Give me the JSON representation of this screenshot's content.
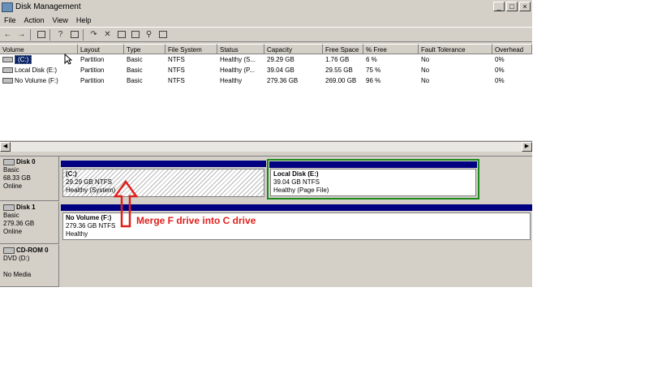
{
  "window": {
    "title": "Disk Management",
    "controls": [
      "_",
      "□",
      "×"
    ]
  },
  "menu": [
    "File",
    "Action",
    "View",
    "Help"
  ],
  "list": {
    "columns": [
      "Volume",
      "Layout",
      "Type",
      "File System",
      "Status",
      "Capacity",
      "Free Space",
      "% Free",
      "Fault Tolerance",
      "Overhead"
    ],
    "rows": [
      [
        "(C:)",
        "Partition",
        "Basic",
        "NTFS",
        "Healthy (S...",
        "29.29 GB",
        "1.76 GB",
        "6 %",
        "No",
        "0%"
      ],
      [
        "Local Disk (E:)",
        "Partition",
        "Basic",
        "NTFS",
        "Healthy (P...",
        "39.04 GB",
        "29.55 GB",
        "75 %",
        "No",
        "0%"
      ],
      [
        "No Volume (F:)",
        "Partition",
        "Basic",
        "NTFS",
        "Healthy",
        "279.36 GB",
        "269.00 GB",
        "96 %",
        "No",
        "0%"
      ]
    ]
  },
  "disks": [
    {
      "name": "Disk 0",
      "type": "Basic",
      "size": "68.33 GB",
      "status": "Online",
      "partitions": [
        {
          "name": "(C:)",
          "size": "29.29 GB NTFS",
          "status": "Healthy (System)"
        },
        {
          "name": "Local Disk  (E:)",
          "size": "39.04 GB NTFS",
          "status": "Healthy (Page File)"
        }
      ]
    },
    {
      "name": "Disk 1",
      "type": "Basic",
      "size": "279.36 GB",
      "status": "Online",
      "partitions": [
        {
          "name": "No Volume  (F:)",
          "size": "279.36 GB NTFS",
          "status": "Healthy"
        }
      ]
    },
    {
      "name": "CD-ROM 0",
      "type": "DVD (D:)",
      "size": "",
      "status": "No Media"
    }
  ],
  "annotation": {
    "text": "Merge F drive into C drive",
    "color": "#e0201c"
  },
  "colors": {
    "partition_bar": "#000080",
    "selection_border": "#1e8a1e",
    "window_bg": "#d4d0c8"
  }
}
